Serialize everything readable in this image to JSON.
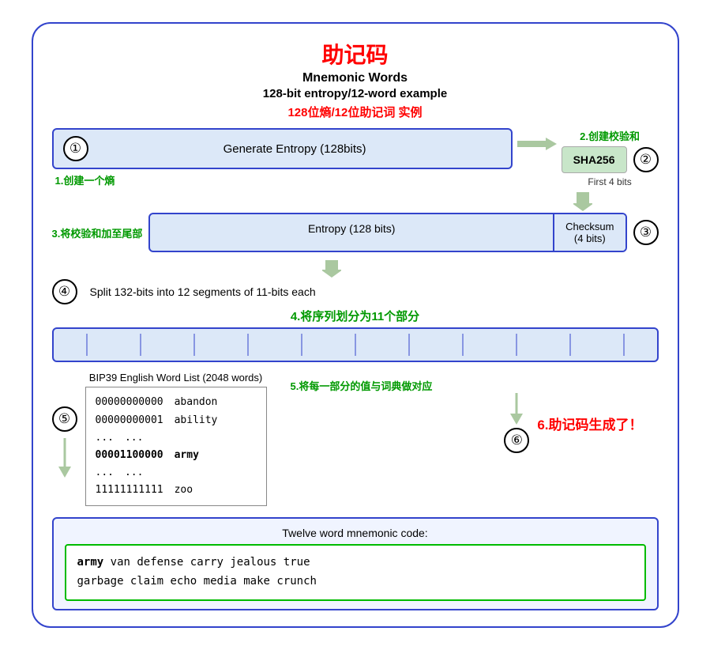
{
  "title": {
    "cn": "助记码",
    "en": "Mnemonic Words",
    "subtitle_en": "128-bit entropy/12-word example",
    "subtitle_cn": "128位熵/12位助记词 实例"
  },
  "step1": {
    "circle": "①",
    "label": "Generate Entropy (128bits)",
    "footnote": "1.创建一个熵"
  },
  "step2": {
    "top_label": "2.创建校验和",
    "circle": "②",
    "sha_label": "SHA256",
    "bits_label": "First 4 bits"
  },
  "step3": {
    "left_label": "3.将校验和加至尾部",
    "entropy_label": "Entropy (128 bits)",
    "checksum_label": "Checksum",
    "checksum_bits": "(4 bits)",
    "circle": "③"
  },
  "step4": {
    "circle": "④",
    "text": "Split 132-bits into 12 segments of 11-bits each",
    "cn_label": "4.将序列划分为11个部分"
  },
  "step5": {
    "circle": "⑤",
    "bip39_title": "BIP39 English Word List (2048 words)",
    "cn_label": "5.将每一部分的值与词典做对应",
    "table_rows": [
      {
        "binary": "00000000000",
        "word": "abandon"
      },
      {
        "binary": "00000000001",
        "word": "ability"
      },
      {
        "binary": "...",
        "word": "..."
      },
      {
        "binary": "00001100000",
        "word": "army",
        "bold": true
      },
      {
        "binary": "...",
        "word": "..."
      },
      {
        "binary": "11111111111",
        "word": "zoo"
      }
    ]
  },
  "step6": {
    "circle": "⑥",
    "cn_label": "6.助记码生成了！"
  },
  "output": {
    "label": "Twelve word mnemonic code:",
    "mnemonic_bold": "army",
    "mnemonic_rest": " van defense carry jealous true\ngarbage claim echo media make crunch"
  }
}
